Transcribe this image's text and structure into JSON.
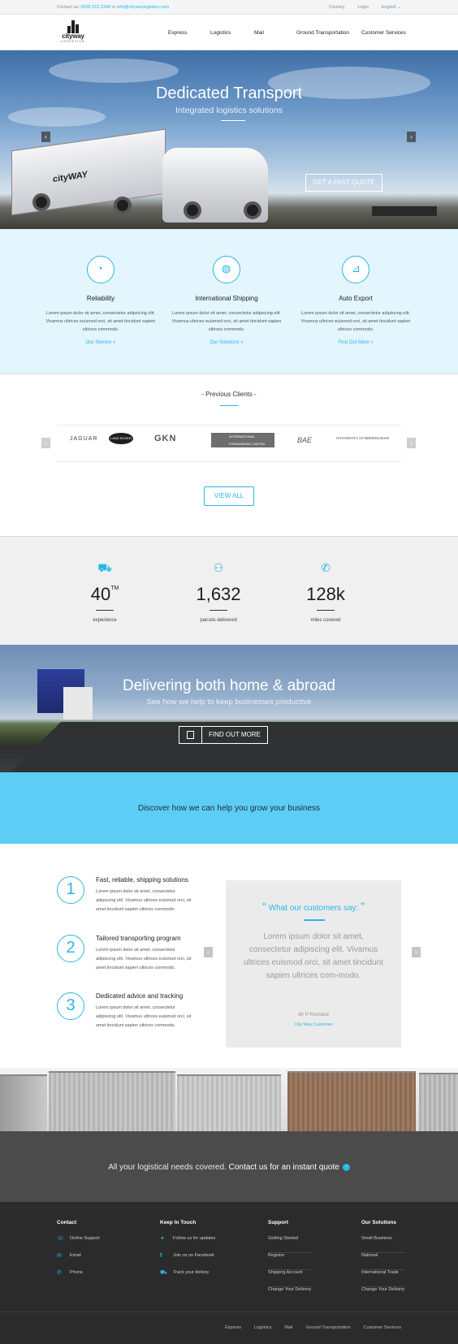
{
  "topbar": {
    "contact_prefix": "Contact us:",
    "phone": "0000 210 2340",
    "or": "or",
    "email": "info@citywaylogistics.com",
    "country": "Country",
    "login": "Login",
    "language": "English"
  },
  "logo": {
    "word": "cityway",
    "sub": "LOGISTICS"
  },
  "nav": {
    "items": [
      "Express",
      "Logistics",
      "Mail",
      "Ground Transportation",
      "Customer Services"
    ]
  },
  "hero": {
    "title": "Dedicated Transport",
    "subtitle": "Integrated logistics solutions",
    "button": "GET A FAST QUOTE",
    "trailer_text": "cityWAY"
  },
  "features": [
    {
      "icon": "apple-icon",
      "title": "Reliability",
      "text": "Lorem ipsum dolor sit amet, consectetur adipiscing elit. Vivamus ultrices euismod orci, sit amet tincidunt sapien ultrices commodo.",
      "link": "Our Service »"
    },
    {
      "icon": "globe-icon",
      "title": "International Shipping",
      "text": "Lorem ipsum dolor sit amet, consectetur adipiscing elit. Vivamus ultrices euismod orci, sit amet tincidunt sapien ultrices commodo.",
      "link": "Our Solutions »"
    },
    {
      "icon": "hand-truck-icon",
      "title": "Auto Export",
      "text": "Lorem ipsum dolor sit amet, consectetur adipiscing elit. Vivamus ultrices euismod orci, sit amet tincidunt sapien ultrices commodo.",
      "link": "Find Out More »"
    }
  ],
  "clients": {
    "title": "- Previous Clients -",
    "logos": [
      "JAGUAR",
      "LAND ROVER",
      "GKN",
      "INTERNATIONAL FORWARDING LIMITED",
      "BAE",
      "UNIVERSITY OF BIRMINGHAM"
    ],
    "button": "VIEW ALL"
  },
  "stats": [
    {
      "icon": "delivery-truck-icon",
      "value": "40",
      "sup": "TM",
      "label": "experience"
    },
    {
      "icon": "parcel-handoff-icon",
      "value": "1,632",
      "sup": "",
      "label": "parcels delivered"
    },
    {
      "icon": "phone-icon",
      "value": "128k",
      "sup": "",
      "label": "miles covered"
    }
  ],
  "road": {
    "title": "Delivering both home & abroad",
    "subtitle": "See how we help to keep businesses productive",
    "button": "FIND OUT MORE"
  },
  "cta": {
    "text": "Discover how we can help you grow your business"
  },
  "services": [
    {
      "n": "1",
      "title": "Fast, reliable, shipping solutions",
      "text": "Lorem ipsum dolor sit amet, consectetur adipiscing elit. Vivamus ultrices euismod orci, sit amet tincidunt sapien ultrices commodo."
    },
    {
      "n": "2",
      "title": "Tailored transporting program",
      "text": "Lorem ipsum dolor sit amet, consectetur adipiscing elit. Vivamus ultrices euismod orci, sit amet tincidunt sapien ultrices commodo."
    },
    {
      "n": "3",
      "title": "Dedicated advice and tracking",
      "text": "Lorem ipsum dolor sit amet, consectetur adipiscing elit. Vivamus ultrices euismod orci, sit amet tincidunt sapien ultrices commodo."
    }
  ],
  "testimonial": {
    "heading": "What our customers say:",
    "quote": "Lorem ipsum dolor sit amet, consectetur adipiscing elit. Vivamus ultrices euismod orci, sit amet tincidunt sapien ultrices com-modo.",
    "name": "Mr P Rowland",
    "role": "City Way Customer"
  },
  "quotebar": {
    "text": "All your logistical needs covered.",
    "link": "Contact us for an instant quote"
  },
  "footer": {
    "contact": {
      "heading": "Contact",
      "items": [
        {
          "icon": "chat-icon",
          "label": "Online Support"
        },
        {
          "icon": "mail-icon",
          "label": "Email"
        },
        {
          "icon": "phone-icon",
          "label": "Phone"
        }
      ]
    },
    "keep": {
      "heading": "Keep In Touch",
      "items": [
        {
          "icon": "twitter-icon",
          "label": "Follow us for updates"
        },
        {
          "icon": "facebook-icon",
          "label": "Join us on Facebook"
        },
        {
          "icon": "truck-icon",
          "label": "Track your delivey"
        }
      ]
    },
    "support": {
      "heading": "Support",
      "items": [
        "Getting Started",
        "Register",
        "Shipping Account",
        "Change Your Delivery"
      ]
    },
    "solutions": {
      "heading": "Our Solutions",
      "items": [
        "Small Business",
        "National",
        "International Trade",
        "Change Your Delivery"
      ]
    }
  },
  "bottom": {
    "links": [
      "Express",
      "Logistics",
      "Mail",
      "Ground Transportation",
      "Customer Services"
    ]
  }
}
